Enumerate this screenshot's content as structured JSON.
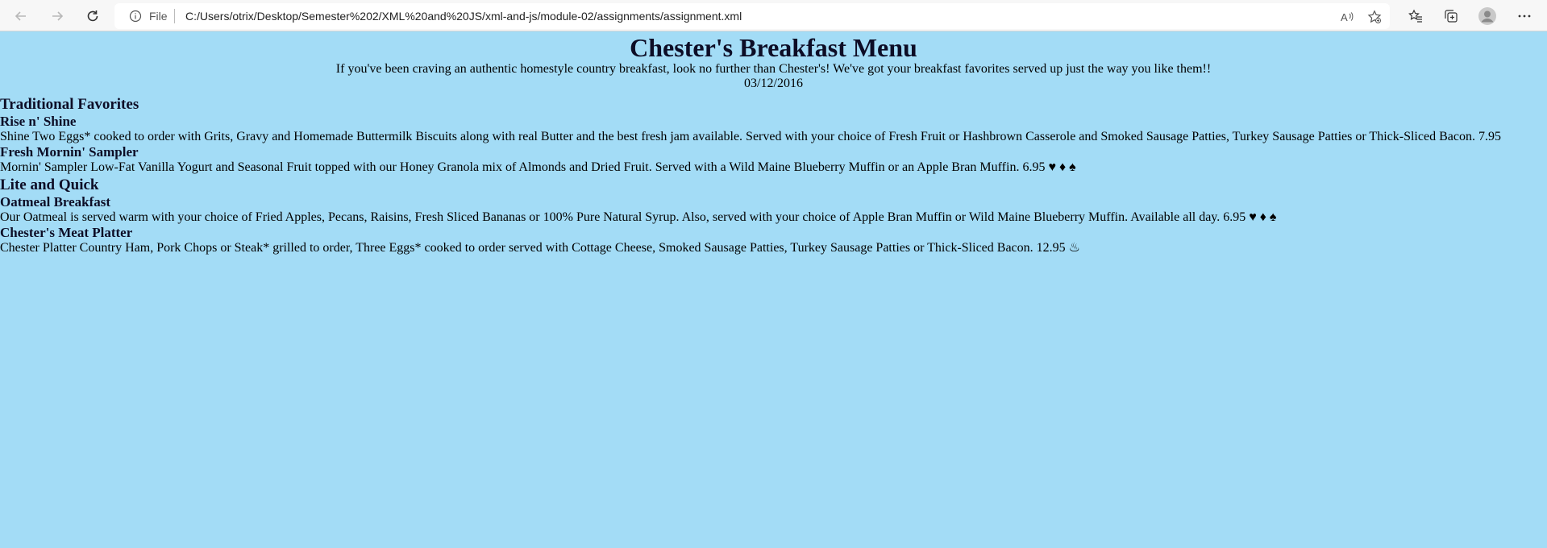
{
  "browser": {
    "file_label": "File",
    "url": "C:/Users/otrix/Desktop/Semester%202/XML%20and%20JS/xml-and-js/module-02/assignments/assignment.xml"
  },
  "menu": {
    "title": "Chester's Breakfast Menu",
    "intro": "If you've been craving an authentic homestyle country breakfast, look no further than Chester's! We've got your breakfast favorites served up just the way you like them!!",
    "date": "03/12/2016",
    "categories": [
      {
        "name": "Traditional Favorites",
        "items": [
          {
            "name": "Rise n' Shine",
            "description": "Shine Two Eggs* cooked to order with Grits, Gravy and Homemade Buttermilk Biscuits along with real Butter and the best fresh jam available. Served with your choice of Fresh Fruit or Hashbrown Casserole and Smoked Sausage Patties, Turkey Sausage Patties or Thick-Sliced Bacon. 7.95"
          },
          {
            "name": "Fresh Mornin' Sampler",
            "description": "Mornin' Sampler Low-Fat Vanilla Yogurt and Seasonal Fruit topped with our Honey Granola mix of Almonds and Dried Fruit. Served with a Wild Maine Blueberry Muffin or an Apple Bran Muffin. 6.95 ♥ ♦ ♠"
          }
        ]
      },
      {
        "name": "Lite and Quick",
        "items": [
          {
            "name": "Oatmeal Breakfast",
            "description": "Our Oatmeal is served warm with your choice of Fried Apples, Pecans, Raisins, Fresh Sliced Bananas or 100% Pure Natural Syrup. Also, served with your choice of Apple Bran Muffin or Wild Maine Blueberry Muffin. Available all day. 6.95 ♥ ♦ ♠"
          },
          {
            "name": "Chester's Meat Platter",
            "description": "Chester Platter Country Ham, Pork Chops or Steak* grilled to order, Three Eggs* cooked to order served with Cottage Cheese, Smoked Sausage Patties, Turkey Sausage Patties or Thick-Sliced Bacon. 12.95 ♨"
          }
        ]
      }
    ]
  }
}
